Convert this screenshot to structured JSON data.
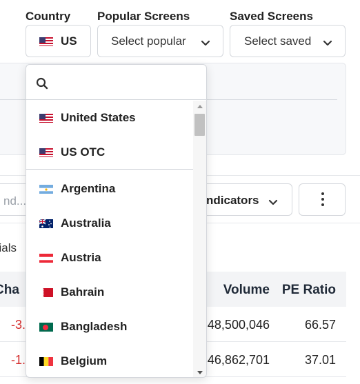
{
  "filters": {
    "country_label": "Country",
    "country_value": "US",
    "popular_label": "Popular Screens",
    "popular_placeholder": "Select popular",
    "saved_label": "Saved Screens",
    "saved_placeholder": "Select saved"
  },
  "toolbar": {
    "search_placeholder": "nd...",
    "indicators_label": "ndicators"
  },
  "tabs": {
    "financials": "cials"
  },
  "table": {
    "headers": {
      "change": "Cha",
      "volume": "Volume",
      "pe": "PE Ratio"
    },
    "rows": [
      {
        "change": "-3.",
        "volume": "48,500,046",
        "pe": "66.57"
      },
      {
        "change": "-1.",
        "volume": "46,862,701",
        "pe": "37.01"
      }
    ]
  },
  "dropdown": {
    "search_value": "",
    "options": [
      {
        "label": "United States",
        "flag": "us-flag-icon"
      },
      {
        "label": "US OTC",
        "flag": "us-flag-icon"
      },
      {
        "label": "Argentina",
        "flag": "argentina-flag-icon"
      },
      {
        "label": "Australia",
        "flag": "australia-flag-icon"
      },
      {
        "label": "Austria",
        "flag": "austria-flag-icon"
      },
      {
        "label": "Bahrain",
        "flag": "bahrain-flag-icon"
      },
      {
        "label": "Bangladesh",
        "flag": "bangladesh-flag-icon"
      },
      {
        "label": "Belgium",
        "flag": "belgium-flag-icon"
      }
    ]
  },
  "colors": {
    "negative": "#d62d2d",
    "border": "#d4d7dc",
    "header_bg": "#f3f4f6"
  }
}
